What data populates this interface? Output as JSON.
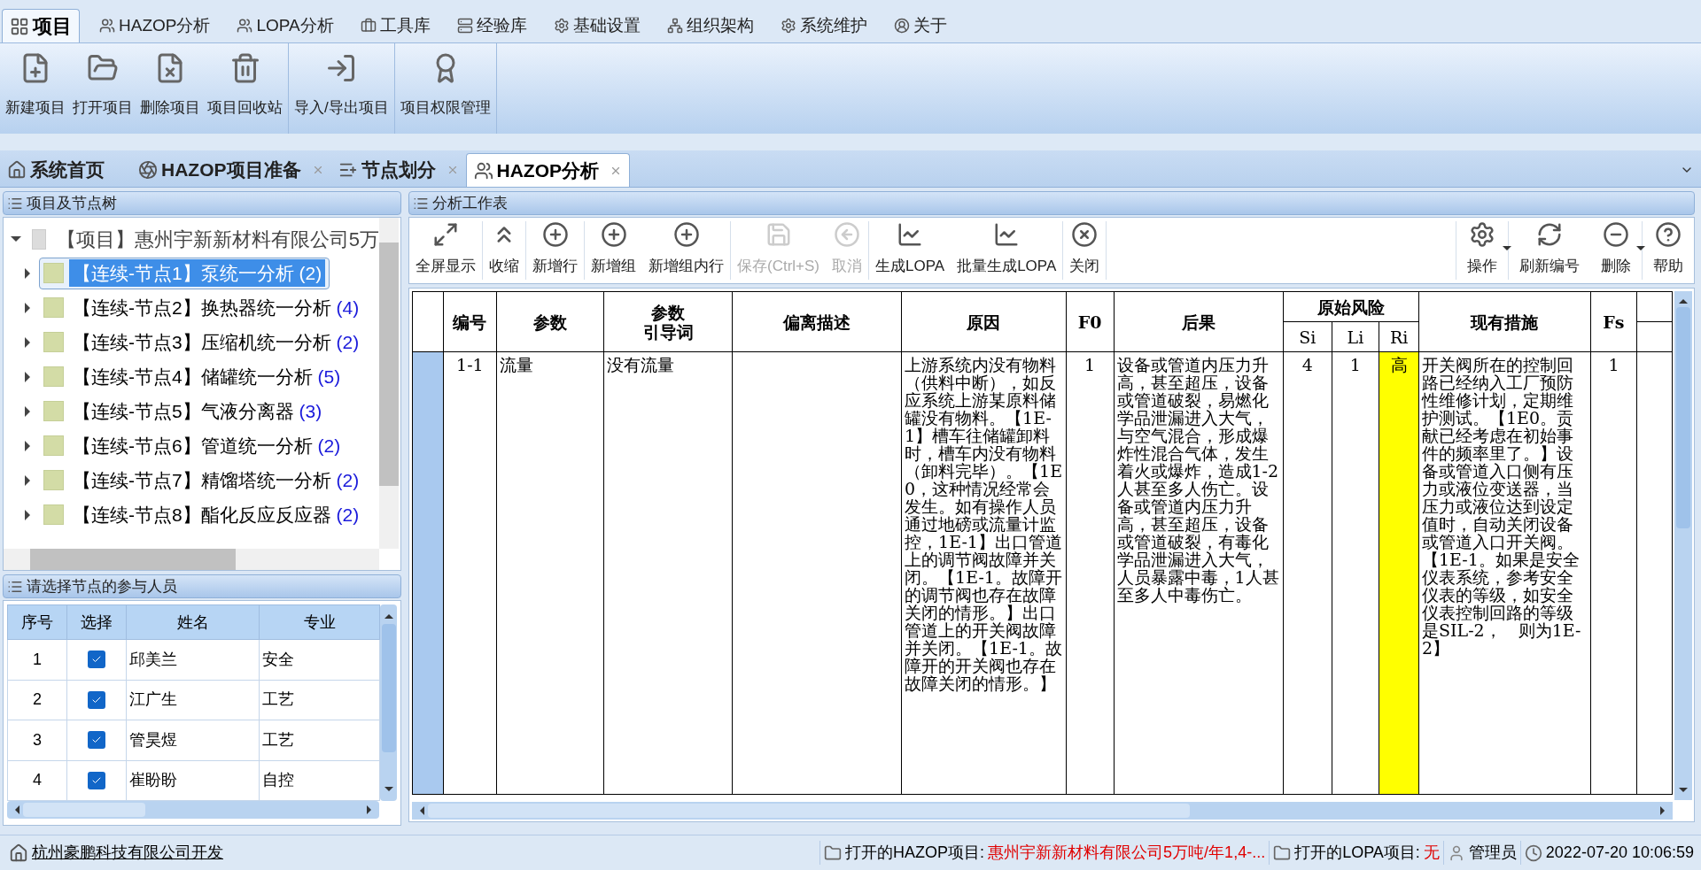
{
  "menu_tabs": [
    {
      "label": "项目",
      "selected": true
    },
    {
      "label": "HAZOP分析",
      "selected": false
    },
    {
      "label": "LOPA分析",
      "selected": false
    },
    {
      "label": "工具库",
      "selected": false
    },
    {
      "label": "经验库",
      "selected": false
    },
    {
      "label": "基础设置",
      "selected": false
    },
    {
      "label": "组织架构",
      "selected": false
    },
    {
      "label": "系统维护",
      "selected": false
    },
    {
      "label": "关于",
      "selected": false
    }
  ],
  "ribbon_groups": [
    {
      "buttons": [
        "新建项目",
        "打开项目",
        "删除项目",
        "项目回收站"
      ]
    },
    {
      "buttons": [
        "导入/导出项目"
      ]
    },
    {
      "buttons": [
        "项目权限管理"
      ]
    }
  ],
  "doc_tabs": [
    {
      "label": "系统首页",
      "selected": false,
      "closable": false
    },
    {
      "label": "HAZOP项目准备",
      "selected": false,
      "closable": true
    },
    {
      "label": "节点划分",
      "selected": false,
      "closable": true
    },
    {
      "label": "HAZOP分析",
      "selected": true,
      "closable": true
    }
  ],
  "tree": {
    "title": "项目及节点树",
    "root": {
      "label": "【项目】惠州宇新新材料有限公司5万",
      "expanded": true,
      "children": [
        {
          "label": "【连续-节点1】泵统一分析",
          "count": "(2)",
          "selected": true
        },
        {
          "label": "【连续-节点2】换热器统一分析",
          "count": "(4)",
          "selected": false
        },
        {
          "label": "【连续-节点3】压缩机统一分析",
          "count": "(2)",
          "selected": false
        },
        {
          "label": "【连续-节点4】储罐统一分析",
          "count": "(5)",
          "selected": false
        },
        {
          "label": "【连续-节点5】气液分离器",
          "count": "(3)",
          "selected": false
        },
        {
          "label": "【连续-节点6】管道统一分析",
          "count": "(2)",
          "selected": false
        },
        {
          "label": "【连续-节点7】精馏塔统一分析",
          "count": "(2)",
          "selected": false
        },
        {
          "label": "【连续-节点8】酯化反应反应器",
          "count": "(2)",
          "selected": false
        }
      ]
    }
  },
  "people": {
    "title": "请选择节点的参与人员",
    "columns": [
      "序号",
      "选择",
      "姓名",
      "专业"
    ],
    "rows": [
      {
        "no": "1",
        "checked": true,
        "name": "邱美兰",
        "major": "安全"
      },
      {
        "no": "2",
        "checked": true,
        "name": "江广生",
        "major": "工艺"
      },
      {
        "no": "3",
        "checked": true,
        "name": "管昊煜",
        "major": "工艺"
      },
      {
        "no": "4",
        "checked": true,
        "name": "崔盼盼",
        "major": "自控"
      }
    ]
  },
  "worksheet": {
    "title": "分析工作表",
    "toolbar_left": [
      [
        {
          "label": "全屏显示",
          "disabled": false
        }
      ],
      [
        {
          "label": "收缩",
          "disabled": false
        }
      ],
      [
        {
          "label": "新增行",
          "disabled": false
        }
      ],
      [
        {
          "label": "新增组",
          "disabled": false
        },
        {
          "label": "新增组内行",
          "disabled": false
        }
      ],
      [
        {
          "label": "保存(Ctrl+S)",
          "disabled": true
        },
        {
          "label": "取消",
          "disabled": true
        }
      ],
      [
        {
          "label": "生成LOPA",
          "disabled": false
        },
        {
          "label": "批量生成LOPA",
          "disabled": false
        }
      ],
      [
        {
          "label": "关闭",
          "disabled": false
        }
      ]
    ],
    "toolbar_right": [
      [
        {
          "label": "操作",
          "dropdown": true
        }
      ],
      [
        {
          "label": "刷新编号",
          "dropdown": false
        },
        {
          "label": "删除",
          "dropdown": true
        }
      ],
      [
        {
          "label": "帮助",
          "dropdown": false
        }
      ]
    ],
    "columns": [
      {
        "label": "编号"
      },
      {
        "label": "参数"
      },
      {
        "lines": [
          "参数",
          "引导词"
        ]
      },
      {
        "label": "偏离描述"
      },
      {
        "label": "原因"
      },
      {
        "label": "F0"
      },
      {
        "label": "后果"
      },
      {
        "label": "原始风险",
        "children": [
          "Si",
          "Li",
          "Ri"
        ]
      },
      {
        "label": "现有措施"
      },
      {
        "label": "Fs"
      }
    ],
    "rows": [
      {
        "no": "1-1",
        "parameter": "流量",
        "guide_word": "没有流量",
        "cause": "上游系统内没有物料（供料中断），如反应系统上游某原料储罐没有物料。【1E-1】槽车往储罐卸料时，槽车内没有物料（卸料完毕）。【1E0，这种情况经常会发生。如有操作人员通过地磅或流量计监控，1E-1】出口管道上的调节阀故障并关闭。【1E-1。故障开的调节阀也存在故障关闭的情形。】出口管道上的开关阀故障并关闭。【1E-1。故障开的开关阀也存在故障关闭的情形。】",
        "f0": "1",
        "consequence": "设备或管道内压力升高，甚至超压，设备或管道破裂，易燃化学品泄漏进入大气，与空气混合，形成爆炸性混合气体，发生着火或爆炸，造成1-2人甚至多人伤亡。设备或管道内压力升高，甚至超压，设备或管道破裂，有毒化学品泄漏进入大气，人员暴露中毒，1人甚至多人中毒伤亡。",
        "si": "4",
        "li": "1",
        "ri": {
          "value": "高",
          "color": "#ffff00"
        },
        "measures": "开关阀所在的控制回路已经纳入工厂预防性维修计划，定期维护测试。【1E0。贡献已经考虑在初始事件的频率里了。】设备或管道入口侧有压力或液位变送器，当压力或液位达到设定值时，自动关闭设备或管道入口开关阀。【1E-1。如果是安全仪表系统，参考安全仪表的等级，如安全仪表控制回路的等级是SIL-2，　则为1E-2】",
        "fs": "1"
      }
    ]
  },
  "status_bar": {
    "developer": "杭州豪鹏科技有限公司开发",
    "hazop_label": "打开的HAZOP项目:",
    "hazop_value": "惠州宇新新材料有限公司5万吨/年1,4-...",
    "lopa_label": "打开的LOPA项目:",
    "lopa_value": "无",
    "user": "管理员",
    "time": "2022-07-20 10:06:59"
  }
}
